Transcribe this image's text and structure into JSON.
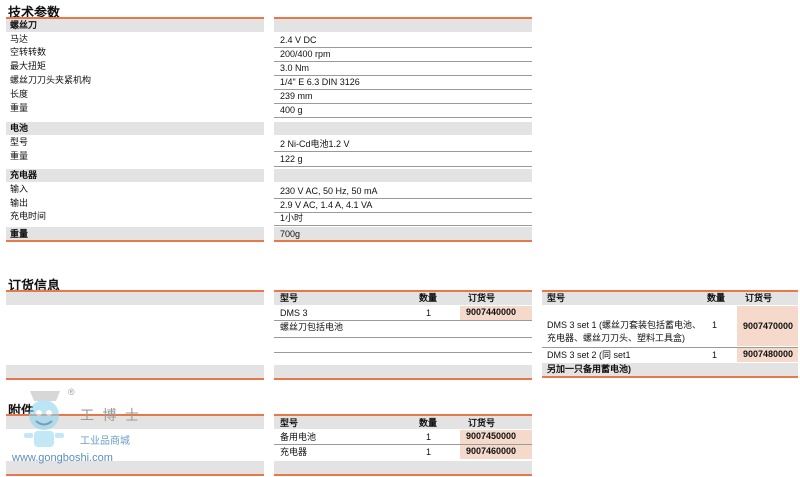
{
  "tech": {
    "title": "技术参数",
    "sections": {
      "screwdriver": "螺丝刀",
      "battery": "电池",
      "charger": "充电器"
    },
    "rows": [
      {
        "label": "马达",
        "value": "2.4 V DC"
      },
      {
        "label": "空转转数",
        "value": "200/400 rpm"
      },
      {
        "label": "最大扭矩",
        "value": "3.0 Nm"
      },
      {
        "label": "螺丝刀刀头夹紧机构",
        "value": "1/4\" E 6.3  DIN 3126"
      },
      {
        "label": "长度",
        "value": "239 mm"
      },
      {
        "label": "重量",
        "value": "400 g"
      },
      {
        "label": "型号",
        "value": "2 Ni-Cd电池1.2 V"
      },
      {
        "label": "重量",
        "value": "122 g"
      },
      {
        "label": "输入",
        "value": "230 V AC, 50 Hz, 50 mA"
      },
      {
        "label": "输出",
        "value": "2.9 V AC, 1.4 A, 4.1 VA"
      },
      {
        "label": "充电时间",
        "value": "1小时"
      },
      {
        "label": "重量",
        "value": "700g"
      }
    ]
  },
  "order": {
    "title": "订货信息",
    "headers": {
      "model": "型号",
      "qty": "数量",
      "order_no": "订货号"
    },
    "left": [
      {
        "model": "DMS 3",
        "qty": "1",
        "order_no": "9007440000",
        "note": "螺丝刀包括电池"
      }
    ],
    "right": [
      {
        "model_line1": "DMS 3 set 1 (螺丝刀套装包括蓄电池、",
        "model_line2": "充电器、螺丝刀刀头、塑料工具盒)",
        "qty": "1",
        "order_no": "9007470000"
      },
      {
        "model": "DMS 3 set 2 (同 set1",
        "qty": "1",
        "order_no": "9007480000",
        "note": "另加一只备用蓄电池)"
      }
    ]
  },
  "accessories": {
    "title": "附件",
    "rows": [
      {
        "model": "备用电池",
        "qty": "1",
        "order_no": "9007450000"
      },
      {
        "model": "充电器",
        "qty": "1",
        "order_no": "9007460000"
      }
    ]
  },
  "watermark": {
    "registered": "®",
    "brand": "工 博 士",
    "tagline": "工业品商城",
    "url": "www.gongboshi.com"
  }
}
